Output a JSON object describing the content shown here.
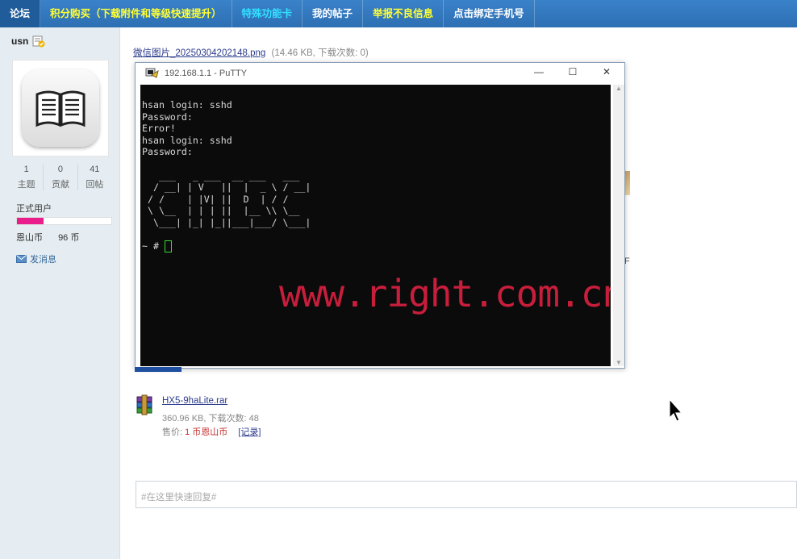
{
  "nav": {
    "items": [
      {
        "label": "论坛",
        "style": "active"
      },
      {
        "label": "积分购买（下载附件和等级快速提升）",
        "style": "yellow"
      },
      {
        "label": "特殊功能卡",
        "style": "cyan"
      },
      {
        "label": "我的帖子",
        "style": "white"
      },
      {
        "label": "举报不良信息",
        "style": "yellow"
      },
      {
        "label": "点击绑定手机号",
        "style": "white"
      }
    ]
  },
  "profile": {
    "username": "usn",
    "stats": [
      {
        "num": "1",
        "label": "主题"
      },
      {
        "num": "0",
        "label": "贡献"
      },
      {
        "num": "41",
        "label": "回帖"
      }
    ],
    "group": "正式用户",
    "progress": 0.28,
    "progress_color": "#e91e8c",
    "money_label": "恩山币",
    "money_value": "96 币",
    "send_message": "发消息"
  },
  "attachment_image": {
    "name": "微信图片_20250304202148.png",
    "meta": "(14.46 KB, 下载次数: 0)"
  },
  "putty": {
    "title": "192.168.1.1 - PuTTY",
    "minimize": "—",
    "maximize": "☐",
    "close": "✕",
    "terminal_lines": [
      "hsan login: sshd",
      "Password:",
      "Error!",
      "hsan login: sshd",
      "Password:",
      "",
      "   ___   _ ___  __ ___   ___",
      "  / __| | V   ||  |  _ \\ / __|",
      " / /    | |V| ||  D  | / /",
      " \\ \\__  | | | ||  |__ \\\\ \\__",
      "  \\___| |_| |_||___|___/ \\___|",
      "",
      "~ #"
    ],
    "watermark": "www.right.com.cn"
  },
  "attachment_rar": {
    "name": "HX5-9haLite.rar",
    "meta": "360.96 KB, 下载次数: 48",
    "price_label": "售价:",
    "price_value": "1 币恩山币",
    "record": "[记录]"
  },
  "reply": {
    "placeholder": "#在这里快速回复#"
  },
  "fragments": {
    "f1": "F"
  }
}
